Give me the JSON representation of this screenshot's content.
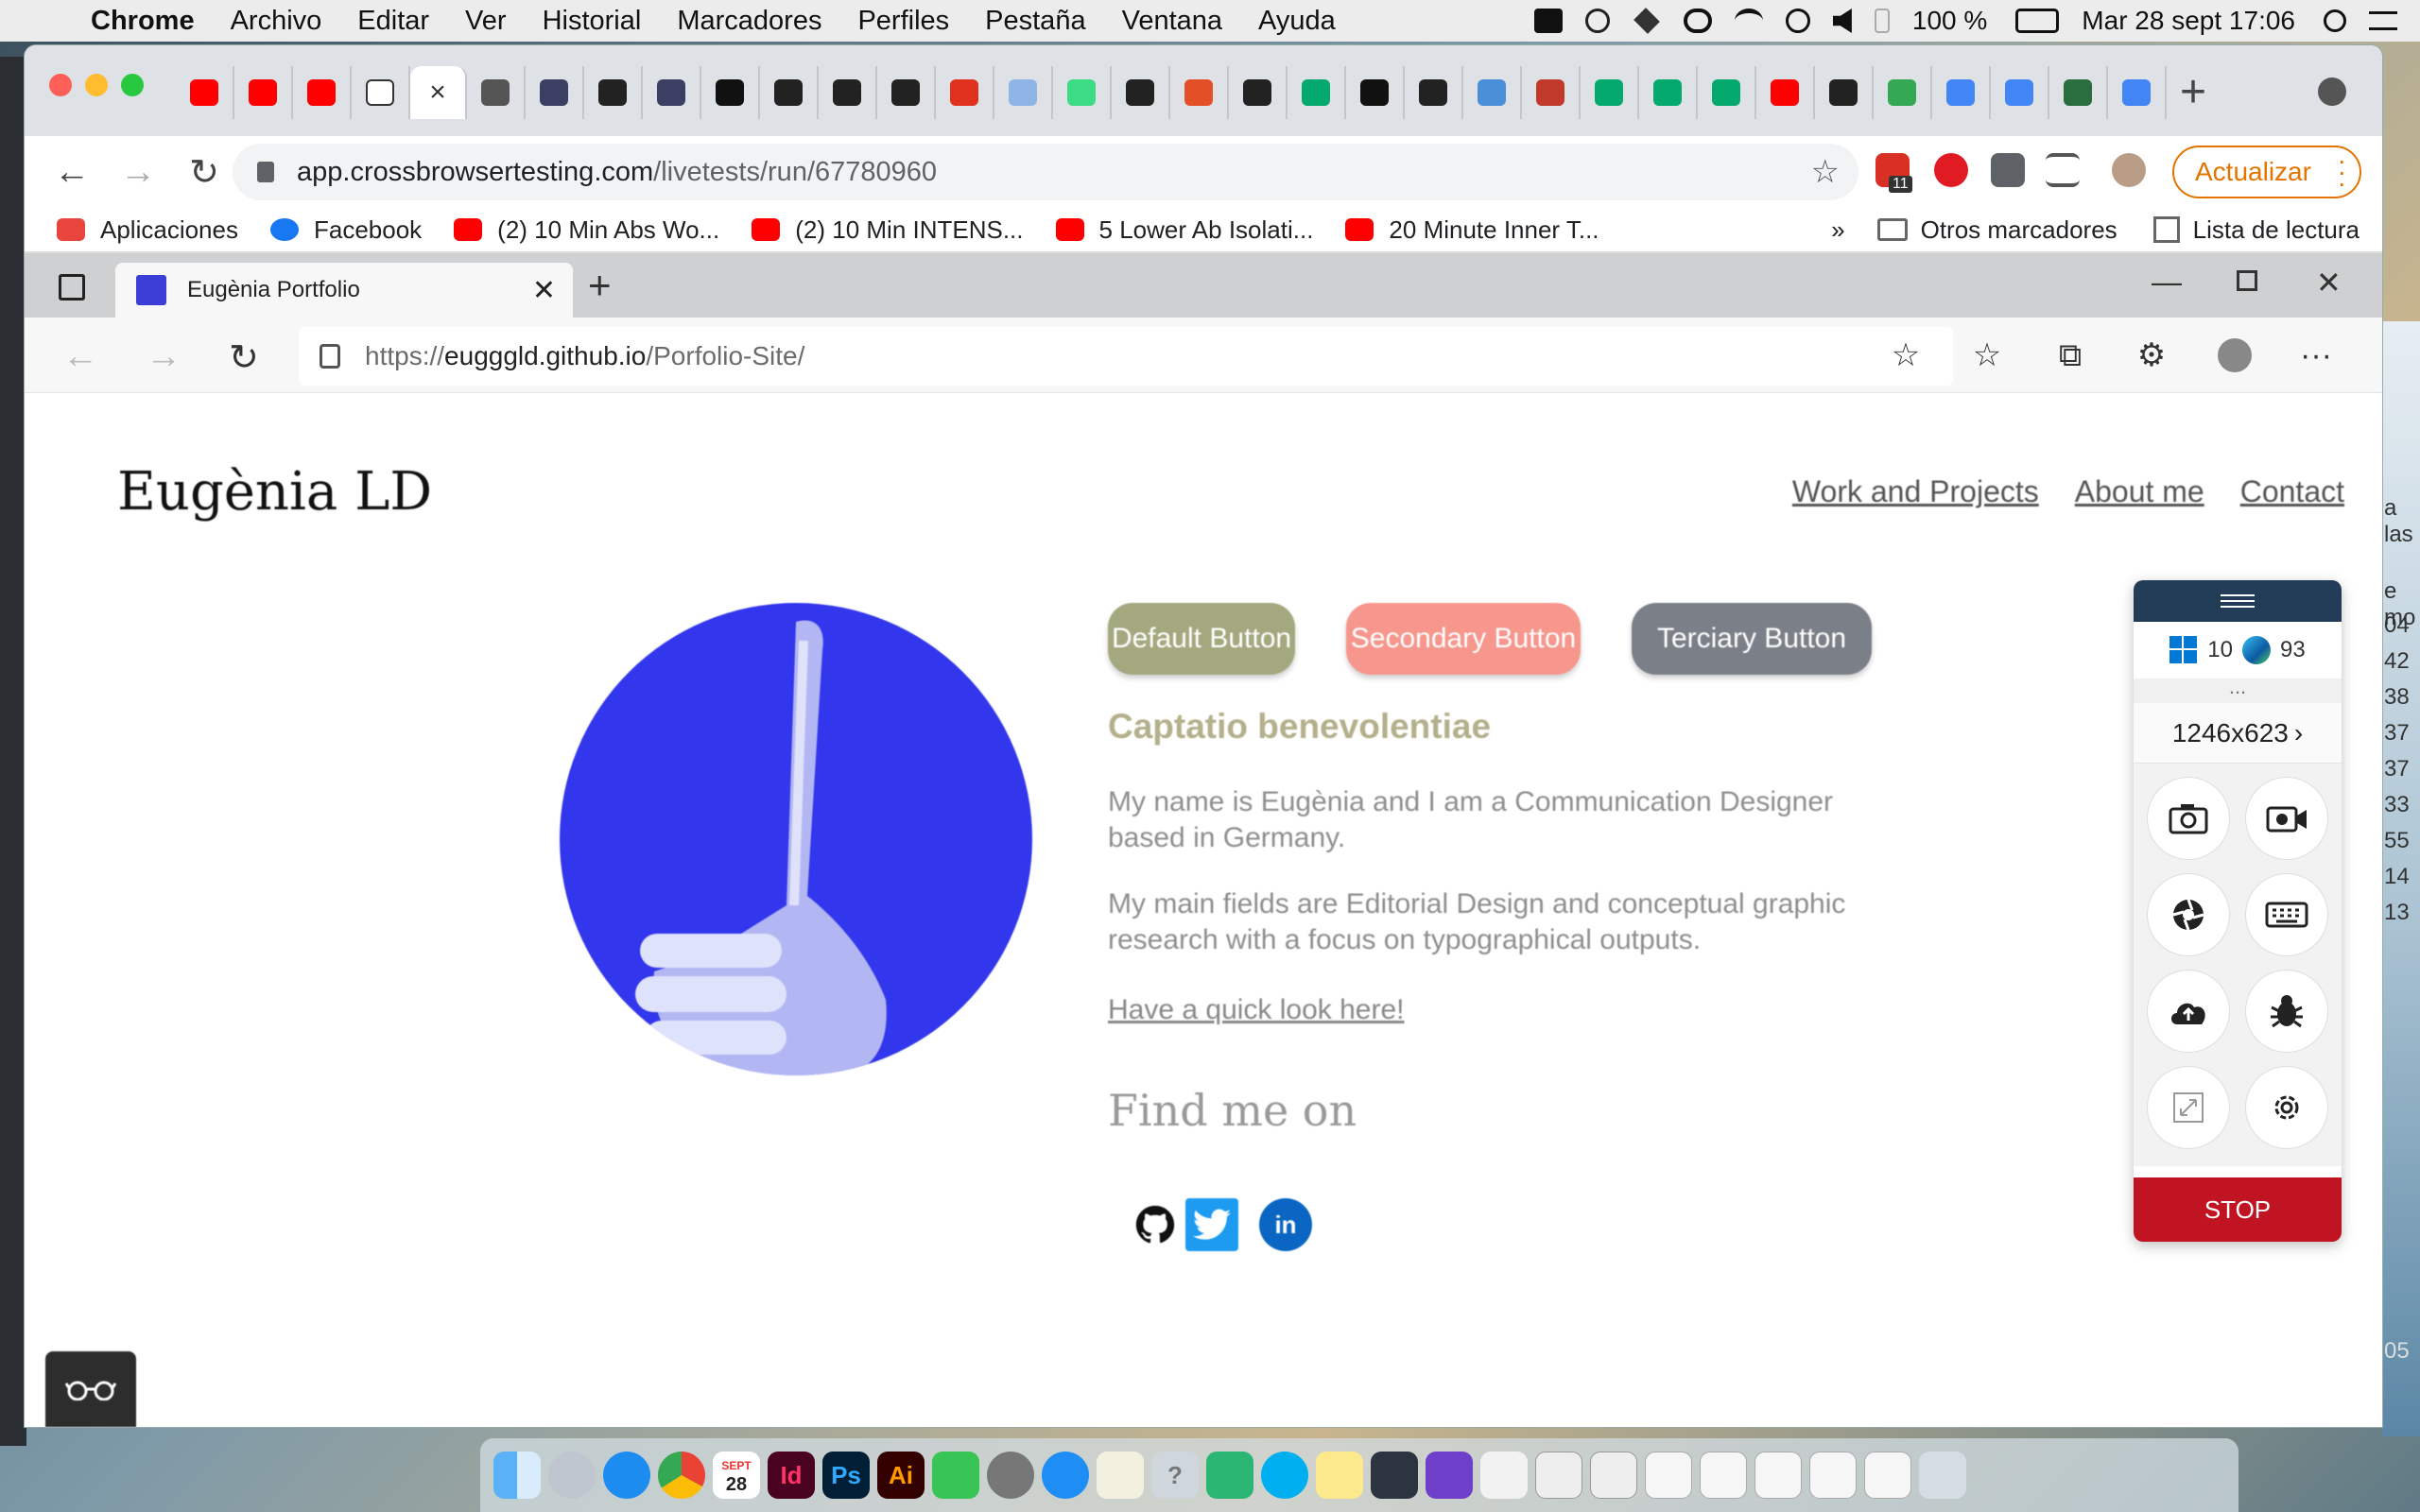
{
  "menubar": {
    "app": "Chrome",
    "items": [
      "Archivo",
      "Editar",
      "Ver",
      "Historial",
      "Marcadores",
      "Perfiles",
      "Pestaña",
      "Ventana",
      "Ayuda"
    ],
    "battery": "100 %",
    "datetime": "Mar 28 sept  17:06"
  },
  "chrome": {
    "tab_favicons": [
      "youtube",
      "youtube",
      "youtube",
      "codeforces",
      "active-close",
      "globe",
      "nu",
      "github",
      "nu",
      "medium",
      "codepen",
      "codepen",
      "codepen",
      "acrobat",
      "cloud",
      "android",
      "github",
      "html5",
      "codepen",
      "w3",
      "notion",
      "codepen",
      "arrow",
      "wrench",
      "w3",
      "w3",
      "w3",
      "youtube",
      "ublock",
      "maps",
      "google",
      "google",
      "es",
      "google"
    ],
    "active_tab_close": "×",
    "url_host": "app.crossbrowsertesting.com",
    "url_path": "/livetests/run/67780960",
    "ext_badge": "11",
    "update_button": "Actualizar",
    "bookmarks": [
      {
        "label": "Aplicaciones",
        "icon": "apps-grid"
      },
      {
        "label": "Facebook",
        "icon": "facebook"
      },
      {
        "label": "(2) 10 Min Abs Wo...",
        "icon": "youtube"
      },
      {
        "label": "(2) 10 Min INTENS...",
        "icon": "youtube"
      },
      {
        "label": "5 Lower Ab Isolati...",
        "icon": "youtube"
      },
      {
        "label": "20 Minute Inner T...",
        "icon": "youtube"
      }
    ],
    "bookmarks_more": "»",
    "other_bookmarks": "Otros marcadores",
    "reading_list": "Lista de lectura"
  },
  "edge": {
    "tab_title": "Eugènia Portfolio",
    "url_prefix": "https://",
    "url_host": "eugggld.github.io",
    "url_path": "/Porfolio-Site/"
  },
  "page": {
    "logo": "Eugènia LD",
    "nav": [
      "Work and Projects",
      "About me",
      "Contact"
    ],
    "buttons": {
      "default": "Default Button",
      "secondary": "Secondary Button",
      "terciary": "Terciary Button"
    },
    "subtitle": "Captatio benevolentiae",
    "para1": "My name is Eugènia and I am a Communication Designer based in Germany.",
    "para2": "My main fields are Editorial Design and conceptual graphic research with a focus on typographical outputs.",
    "link": "Have a quick look here!",
    "find_me": "Find me on",
    "social": [
      "github",
      "twitter",
      "linkedin"
    ],
    "colors": {
      "default": "#a4a87e",
      "secondary": "#f6968c",
      "terciary": "#7b8088",
      "avatar": "#3236ec"
    }
  },
  "cbt_panel": {
    "os_version": "10",
    "browser_version": "93",
    "more": "...",
    "resolution": "1246x623",
    "stop": "STOP",
    "tools": [
      "camera-icon",
      "video-icon",
      "aperture-icon",
      "keyboard-icon",
      "upload-cloud-icon",
      "bug-icon",
      "resize-icon",
      "settings-icon"
    ]
  },
  "desktop_text": {
    "lines": [
      "a las",
      "e mo",
      "04",
      "42",
      "38",
      "37",
      "37",
      "33",
      "55",
      "14",
      "13",
      "05"
    ]
  },
  "dock": {
    "calendar_month": "SEPT",
    "calendar_day": "28",
    "apps": [
      "Id",
      "Ps",
      "Ai"
    ]
  }
}
